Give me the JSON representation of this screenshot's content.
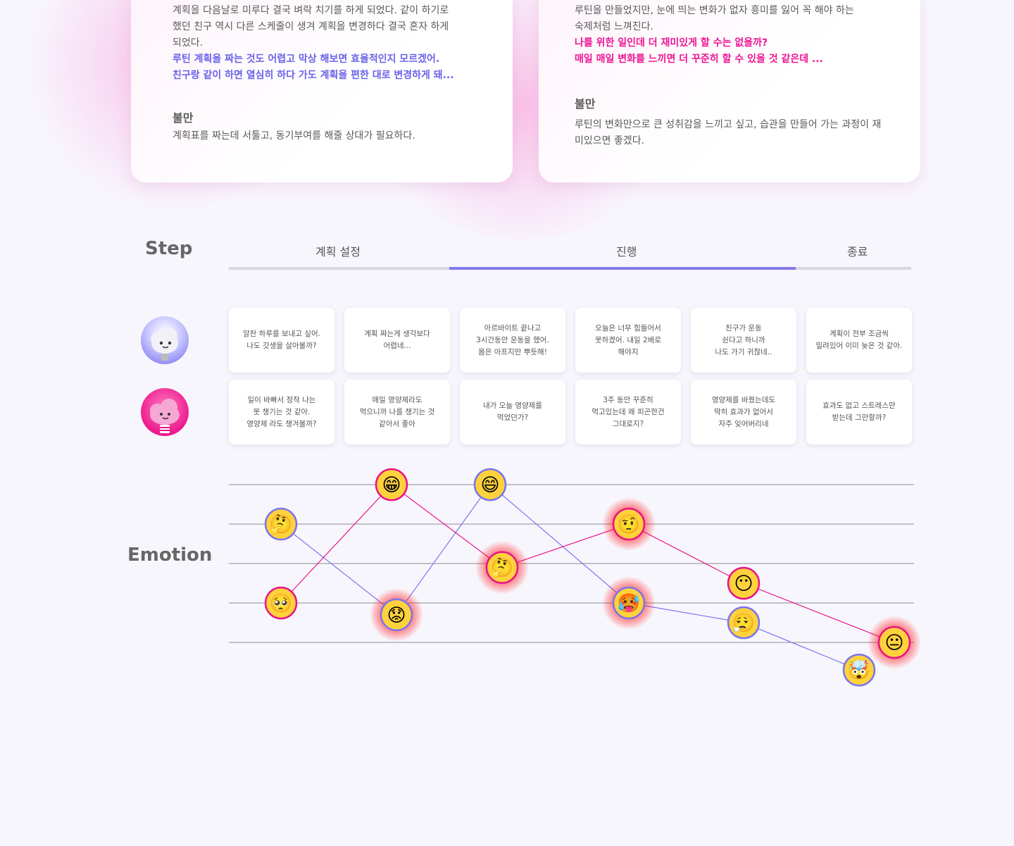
{
  "persona_cards": [
    {
      "body_lines": [
        "계획을 다음날로 미루다 결국 벼락 치기를 하게 되었다. 같이 하기로",
        "했던 친구 역시 다른 스케줄이 생겨 계획을 변경하다 결국 혼자 하게",
        "되었다."
      ],
      "highlight_lines": [
        "루틴 계획을 짜는 것도 어렵고 막상 해보면 효율적인지 모르겠어.",
        "친구랑 같이 하면 열심히 하다 가도 계획을 편한 대로 변경하게 돼..."
      ],
      "heading": "불만",
      "heading_text": "계획표를 짜는데 서툴고, 동기부여를 해줄 상대가 필요하다."
    },
    {
      "body_lines": [
        "루틴을 만들었지만, 눈에 띄는 변화가 없자 흥미를 잃어 꼭 해야 하는",
        "숙제처럼 느껴진다."
      ],
      "highlight_lines": [
        "나를 위한 일인데 더 재미있게 할 수는 없을까?",
        "매일 매일 변화를 느끼면 더 꾸준히 할 수 있을 것 같은데 ..."
      ],
      "heading": "불만",
      "heading_text": "루틴의 변화만으로 큰 성취감을 느끼고 싶고, 습관을 만들어 가는 과정이 재미있으면 좋겠다."
    }
  ],
  "step": {
    "title": "Step",
    "phases": [
      "계획 설정",
      "진행",
      "종료"
    ],
    "colors": {
      "inactive": "#d9d7dd",
      "active": "#8279ea"
    }
  },
  "personas": [
    {
      "avatar_icon": "cloud-character-blue-icon",
      "color": "#7a74ee",
      "quotes": [
        "알찬 하루를 보내고 싶어.\n나도 갓생을 살아볼까?",
        "계획 짜는게 생각보다\n어렵네...",
        "아르바이트 끝나고\n3시간동안 운동을 했어.\n몸은 아프지만 뿌듯해!",
        "오늘은 너무 힘들어서\n못하겠어. 내일 2배로\n해야지",
        "친구가 운동\n쉰다고 하니까\n나도 가기 귀찮네..",
        "계획이 전부 조금씩\n밀려있어 이미 늦은 것 같아."
      ]
    },
    {
      "avatar_icon": "cloud-character-pink-icon",
      "color": "#e8138a",
      "quotes": [
        "일이 바빠서 정작 나는\n못 챙기는 것 같아.\n영양제 라도 챙겨볼까?",
        "매일 영양제라도\n먹으니까 나를 챙기는 것\n같아서 좋아",
        "내가 오늘 영양제를\n먹었던가?",
        "3주 동안 꾸준히\n먹고있는데 왜 피곤한건\n그대로지?",
        "영양제를 바꿨는데도\n딱히 효과가 없어서\n자주 잊어버리네",
        "효과도 없고 스트레스만\n받는데 그만할까?"
      ]
    }
  ],
  "emotion": {
    "title": "Emotion",
    "blue_path": [
      {
        "emoji": "🤔",
        "level": 3,
        "negative": false
      },
      {
        "emoji": "😟",
        "level": 0.7,
        "negative": true
      },
      {
        "emoji": "😄",
        "level": 4,
        "negative": false
      },
      {
        "emoji": "🥵",
        "level": 1,
        "negative": true
      },
      {
        "emoji": "😮‍💨",
        "level": 0.5,
        "negative": false
      },
      {
        "emoji": "🤯",
        "level": -0.7,
        "negative": false
      }
    ],
    "pink_path": [
      {
        "emoji": "🥺",
        "level": 1,
        "negative": false
      },
      {
        "emoji": "😁",
        "level": 4,
        "negative": false
      },
      {
        "emoji": "🤔",
        "level": 1.9,
        "negative": true
      },
      {
        "emoji": "🤨",
        "level": 3,
        "negative": true
      },
      {
        "emoji": "😶",
        "level": 1.5,
        "negative": false
      },
      {
        "emoji": "😐",
        "level": 0,
        "negative": true
      }
    ]
  }
}
